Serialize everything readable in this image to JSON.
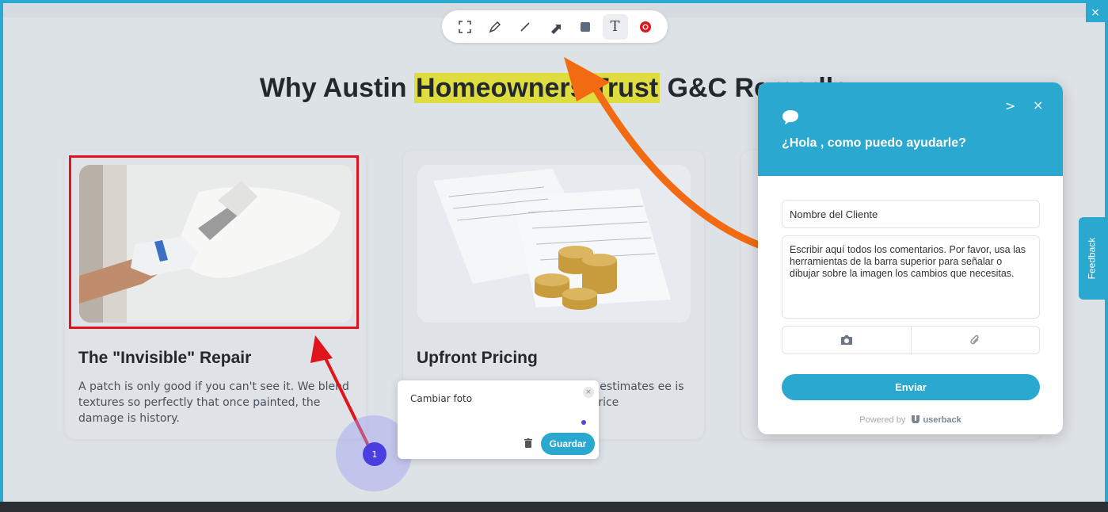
{
  "toolbar": {
    "tools": [
      {
        "name": "select-area",
        "icon": "crop-frame-icon"
      },
      {
        "name": "pen",
        "icon": "pen-icon"
      },
      {
        "name": "line",
        "icon": "line-icon"
      },
      {
        "name": "arrow",
        "icon": "arrow-icon"
      },
      {
        "name": "rectangle",
        "icon": "rectangle-icon"
      },
      {
        "name": "text",
        "icon": "text-icon",
        "label": "T",
        "active": true
      },
      {
        "name": "record",
        "icon": "record-icon"
      }
    ]
  },
  "page": {
    "headline_pre": "Why Austin ",
    "headline_highlight": "Homeowners Trust",
    "headline_post": " G&C Remodle",
    "cards": [
      {
        "title": "The \"Invisible\" Repair",
        "text": "A patch is only good if you can't see it. We blend textures so perfectly that once painted, the damage is history."
      },
      {
        "title": "Upfront Pricing",
        "text": "ailed estimates ee is the price"
      }
    ]
  },
  "comment": {
    "marker_number": "1",
    "text": "Cambiar foto",
    "save_label": "Guardar",
    "close_label": "×"
  },
  "widget": {
    "title": "¿Hola , como puedo ayudarle?",
    "name_field": "Nombre del Cliente",
    "comment_field": "Escribir aquí todos los comentarios. Por favor, usa las herramientas de la barra superior para señalar o dibujar sobre la imagen los cambios que necesitas.",
    "send_label": "Enviar",
    "powered_prefix": "Powered by",
    "powered_brand": "userback",
    "next_label": ">",
    "close_label": "×"
  },
  "feedback_tab": {
    "label": "Feedback"
  },
  "corner_close": "×",
  "colors": {
    "accent": "#2aa8cf",
    "annotation_red": "#e0141c",
    "annotation_orange": "#f26a12",
    "highlight": "#dedc3f",
    "marker": "#4b3ee0"
  }
}
